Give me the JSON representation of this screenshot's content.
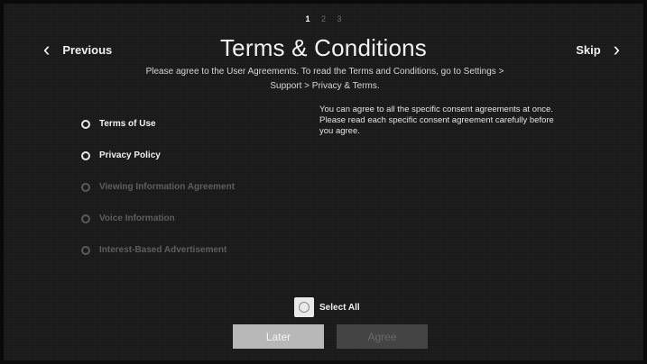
{
  "steps": [
    "1",
    "2",
    "3"
  ],
  "active_step": "1",
  "header": {
    "previous_label": "Previous",
    "title": "Terms & Conditions",
    "skip_label": "Skip",
    "subtitle_line1": "Please agree to the User Agreements. To read the Terms and Conditions, go to Settings >",
    "subtitle_line2": "Support > Privacy & Terms."
  },
  "options": [
    {
      "label": "Terms of Use",
      "enabled": true,
      "checked": false
    },
    {
      "label": "Privacy Policy",
      "enabled": true,
      "checked": false
    },
    {
      "label": "Viewing Information Agreement",
      "enabled": false,
      "checked": false
    },
    {
      "label": "Voice Information",
      "enabled": false,
      "checked": false
    },
    {
      "label": "Interest-Based Advertisement",
      "enabled": false,
      "checked": false
    }
  ],
  "info": {
    "line1": "You can agree to all the specific consent agreements at once.",
    "line2": "Please read each specific consent agreement carefully before",
    "line3": "you agree."
  },
  "select_all_label": "Select All",
  "buttons": {
    "later_label": "Later",
    "agree_label": "Agree"
  },
  "colors": {
    "background": "#1b1b1b",
    "text": "#f0f0f0",
    "disabled_text": "#5e5e5e",
    "later_button": "#b8b8b8",
    "agree_button_disabled": "#444444"
  }
}
